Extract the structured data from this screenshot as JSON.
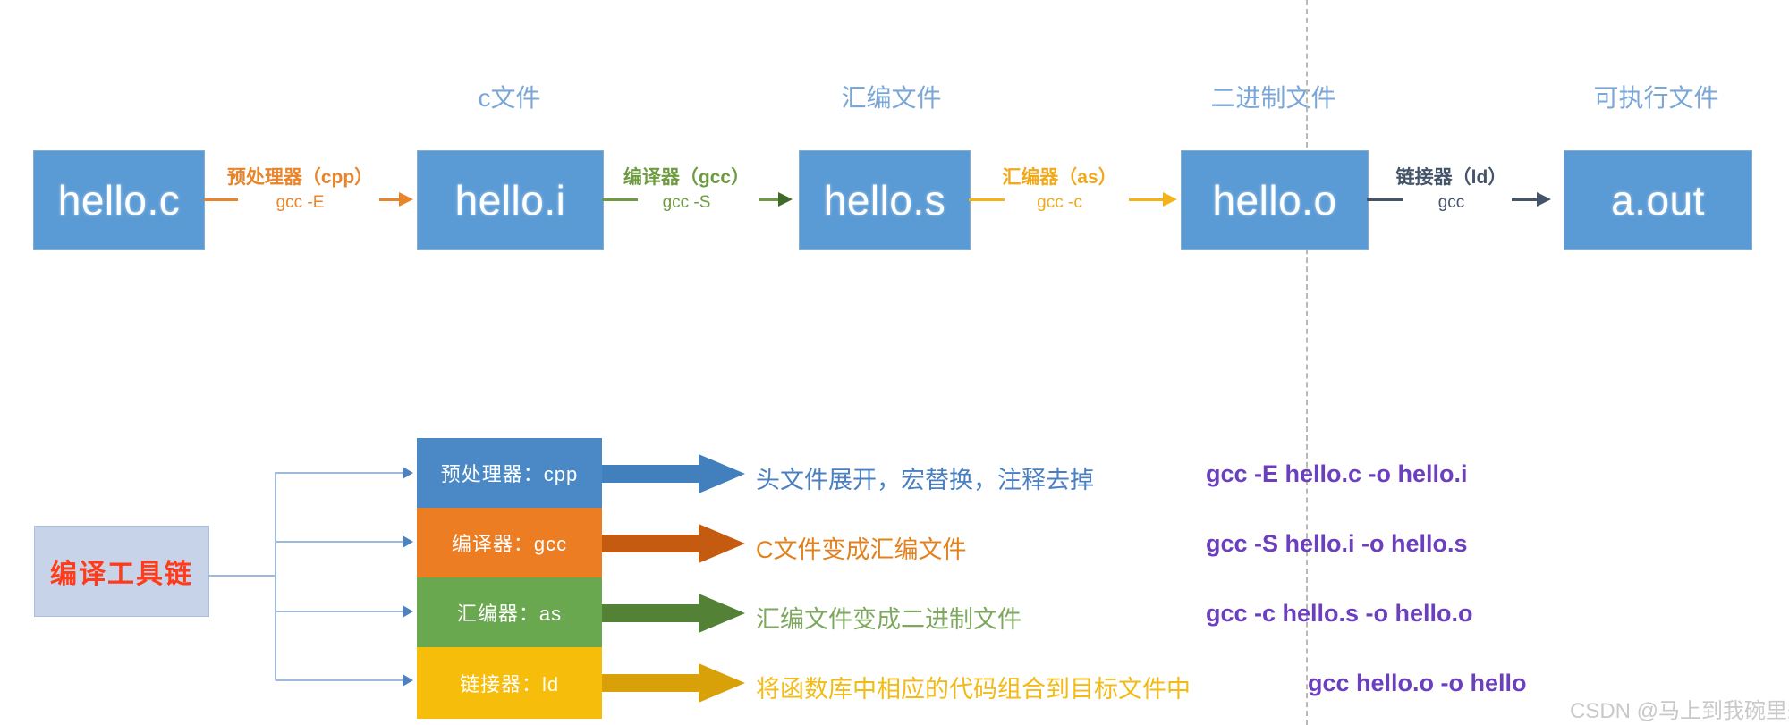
{
  "pipeline": {
    "stages": [
      {
        "box_label": "hello.c",
        "cap_label": ""
      },
      {
        "box_label": "hello.i",
        "cap_label": "c文件"
      },
      {
        "box_label": "hello.s",
        "cap_label": "汇编文件"
      },
      {
        "box_label": "hello.o",
        "cap_label": "二进制文件"
      },
      {
        "box_label": "a.out",
        "cap_label": "可执行文件"
      }
    ],
    "connectors": [
      {
        "title": "预处理器（cpp）",
        "command": "gcc -E",
        "color": "#E8842A"
      },
      {
        "title": "编译器（gcc）",
        "command": "gcc -S",
        "color": "#6E9B41"
      },
      {
        "title": "汇编器（as）",
        "command": "gcc -c",
        "color": "#F5B318"
      },
      {
        "title": "链接器（ld）",
        "command": "gcc",
        "color": "#44546A"
      }
    ]
  },
  "toolchain": {
    "title": "编译工具链",
    "title_color": "#FF3B19",
    "box_color": "#C7D3E8",
    "stages": [
      {
        "name": "预处理器：cpp",
        "band_color": "#4A89C6",
        "arrow_color": "#4180BD",
        "description": "头文件展开，宏替换，注释去掉",
        "desc_color": "#4A7FC1",
        "command": "gcc -E hello.c -o hello.i"
      },
      {
        "name": "编译器：gcc",
        "band_color": "#ED7D23",
        "arrow_color": "#C55A11",
        "description": "C文件变成汇编文件",
        "desc_color": "#E2821F",
        "command": "gcc -S hello.i -o hello.s"
      },
      {
        "name": "汇编器：as",
        "band_color": "#6AA84F",
        "arrow_color": "#538135",
        "description": "汇编文件变成二进制文件",
        "desc_color": "#7DA85E",
        "command": "gcc -c hello.s -o hello.o"
      },
      {
        "name": "链接器：ld",
        "band_color": "#F6BE0B",
        "arrow_color": "#D9A109",
        "description": "将函数库中相应的代码组合到目标文件中",
        "desc_color": "#F2BB17",
        "command": "gcc hello.o -o hello"
      }
    ]
  },
  "watermark": "CSDN @马上到我碗里来"
}
